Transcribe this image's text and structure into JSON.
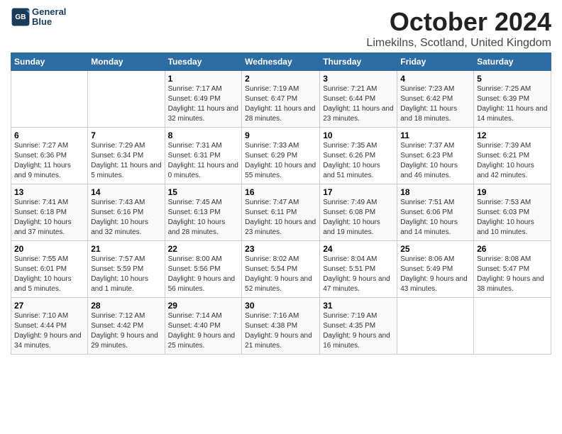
{
  "logo": {
    "line1": "General",
    "line2": "Blue"
  },
  "title": "October 2024",
  "subtitle": "Limekilns, Scotland, United Kingdom",
  "days_of_week": [
    "Sunday",
    "Monday",
    "Tuesday",
    "Wednesday",
    "Thursday",
    "Friday",
    "Saturday"
  ],
  "weeks": [
    [
      {
        "day": "",
        "info": ""
      },
      {
        "day": "",
        "info": ""
      },
      {
        "day": "1",
        "info": "Sunrise: 7:17 AM\nSunset: 6:49 PM\nDaylight: 11 hours and 32 minutes."
      },
      {
        "day": "2",
        "info": "Sunrise: 7:19 AM\nSunset: 6:47 PM\nDaylight: 11 hours and 28 minutes."
      },
      {
        "day": "3",
        "info": "Sunrise: 7:21 AM\nSunset: 6:44 PM\nDaylight: 11 hours and 23 minutes."
      },
      {
        "day": "4",
        "info": "Sunrise: 7:23 AM\nSunset: 6:42 PM\nDaylight: 11 hours and 18 minutes."
      },
      {
        "day": "5",
        "info": "Sunrise: 7:25 AM\nSunset: 6:39 PM\nDaylight: 11 hours and 14 minutes."
      }
    ],
    [
      {
        "day": "6",
        "info": "Sunrise: 7:27 AM\nSunset: 6:36 PM\nDaylight: 11 hours and 9 minutes."
      },
      {
        "day": "7",
        "info": "Sunrise: 7:29 AM\nSunset: 6:34 PM\nDaylight: 11 hours and 5 minutes."
      },
      {
        "day": "8",
        "info": "Sunrise: 7:31 AM\nSunset: 6:31 PM\nDaylight: 11 hours and 0 minutes."
      },
      {
        "day": "9",
        "info": "Sunrise: 7:33 AM\nSunset: 6:29 PM\nDaylight: 10 hours and 55 minutes."
      },
      {
        "day": "10",
        "info": "Sunrise: 7:35 AM\nSunset: 6:26 PM\nDaylight: 10 hours and 51 minutes."
      },
      {
        "day": "11",
        "info": "Sunrise: 7:37 AM\nSunset: 6:23 PM\nDaylight: 10 hours and 46 minutes."
      },
      {
        "day": "12",
        "info": "Sunrise: 7:39 AM\nSunset: 6:21 PM\nDaylight: 10 hours and 42 minutes."
      }
    ],
    [
      {
        "day": "13",
        "info": "Sunrise: 7:41 AM\nSunset: 6:18 PM\nDaylight: 10 hours and 37 minutes."
      },
      {
        "day": "14",
        "info": "Sunrise: 7:43 AM\nSunset: 6:16 PM\nDaylight: 10 hours and 32 minutes."
      },
      {
        "day": "15",
        "info": "Sunrise: 7:45 AM\nSunset: 6:13 PM\nDaylight: 10 hours and 28 minutes."
      },
      {
        "day": "16",
        "info": "Sunrise: 7:47 AM\nSunset: 6:11 PM\nDaylight: 10 hours and 23 minutes."
      },
      {
        "day": "17",
        "info": "Sunrise: 7:49 AM\nSunset: 6:08 PM\nDaylight: 10 hours and 19 minutes."
      },
      {
        "day": "18",
        "info": "Sunrise: 7:51 AM\nSunset: 6:06 PM\nDaylight: 10 hours and 14 minutes."
      },
      {
        "day": "19",
        "info": "Sunrise: 7:53 AM\nSunset: 6:03 PM\nDaylight: 10 hours and 10 minutes."
      }
    ],
    [
      {
        "day": "20",
        "info": "Sunrise: 7:55 AM\nSunset: 6:01 PM\nDaylight: 10 hours and 5 minutes."
      },
      {
        "day": "21",
        "info": "Sunrise: 7:57 AM\nSunset: 5:59 PM\nDaylight: 10 hours and 1 minute."
      },
      {
        "day": "22",
        "info": "Sunrise: 8:00 AM\nSunset: 5:56 PM\nDaylight: 9 hours and 56 minutes."
      },
      {
        "day": "23",
        "info": "Sunrise: 8:02 AM\nSunset: 5:54 PM\nDaylight: 9 hours and 52 minutes."
      },
      {
        "day": "24",
        "info": "Sunrise: 8:04 AM\nSunset: 5:51 PM\nDaylight: 9 hours and 47 minutes."
      },
      {
        "day": "25",
        "info": "Sunrise: 8:06 AM\nSunset: 5:49 PM\nDaylight: 9 hours and 43 minutes."
      },
      {
        "day": "26",
        "info": "Sunrise: 8:08 AM\nSunset: 5:47 PM\nDaylight: 9 hours and 38 minutes."
      }
    ],
    [
      {
        "day": "27",
        "info": "Sunrise: 7:10 AM\nSunset: 4:44 PM\nDaylight: 9 hours and 34 minutes."
      },
      {
        "day": "28",
        "info": "Sunrise: 7:12 AM\nSunset: 4:42 PM\nDaylight: 9 hours and 29 minutes."
      },
      {
        "day": "29",
        "info": "Sunrise: 7:14 AM\nSunset: 4:40 PM\nDaylight: 9 hours and 25 minutes."
      },
      {
        "day": "30",
        "info": "Sunrise: 7:16 AM\nSunset: 4:38 PM\nDaylight: 9 hours and 21 minutes."
      },
      {
        "day": "31",
        "info": "Sunrise: 7:19 AM\nSunset: 4:35 PM\nDaylight: 9 hours and 16 minutes."
      },
      {
        "day": "",
        "info": ""
      },
      {
        "day": "",
        "info": ""
      }
    ]
  ]
}
